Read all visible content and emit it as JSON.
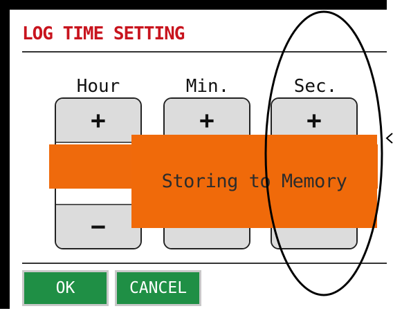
{
  "screen": {
    "title": "LOG TIME SETTING"
  },
  "columns": [
    {
      "label": "Hour",
      "plus": "+",
      "minus": "−"
    },
    {
      "label": "Min.",
      "plus": "+",
      "minus": ""
    },
    {
      "label": "Sec.",
      "plus": "+",
      "minus": ""
    }
  ],
  "overlay": {
    "message": "Storing to Memory",
    "color": "#f06a0a"
  },
  "actions": {
    "ok_label": "OK",
    "cancel_label": "CANCEL",
    "color": "#1f8f45"
  },
  "colors": {
    "title": "#c8141e",
    "button_face": "#dcdcdc",
    "annotation_outline": "#000000"
  }
}
